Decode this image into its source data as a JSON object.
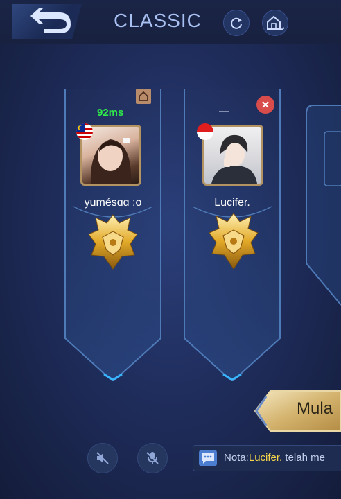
{
  "header": {
    "mode_title": "CLASSIC",
    "back_icon": "back-arrow-icon",
    "refresh_icon": "refresh-icon",
    "home_icon": "home-dropdown-icon"
  },
  "players": [
    {
      "ping": "92ms",
      "name": "yumésɑɑ :o",
      "flag": "malaysia",
      "badge": "home-icon"
    },
    {
      "ping": "—",
      "name": "Lucifer.",
      "flag": "indonesia",
      "badge": "close-icon"
    }
  ],
  "actions": {
    "start_label": "Mula"
  },
  "chat": {
    "prefix": "Nota:",
    "name": "Lucifer.",
    "message": " telah me"
  },
  "colors": {
    "ping_green": "#2fe84a",
    "gold": "#d7b878",
    "close_red": "#d94c4c",
    "chat_name": "#f5d64a"
  }
}
